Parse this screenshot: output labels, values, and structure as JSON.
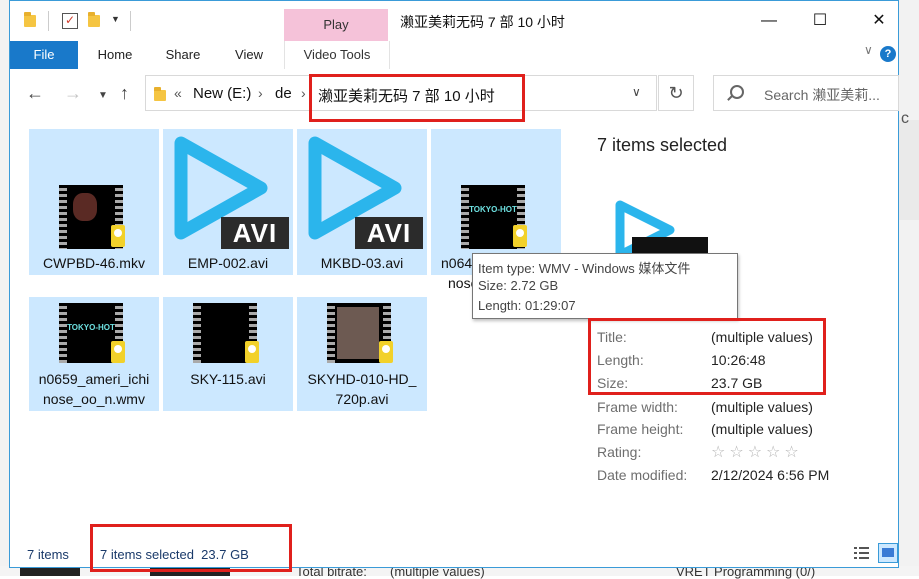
{
  "window": {
    "title": "濑亚美莉无码 7 部 10 小时",
    "context_tab": "Play"
  },
  "ribbon": {
    "tabs": [
      "File",
      "Home",
      "Share",
      "View",
      "Video Tools"
    ]
  },
  "nav": {
    "breadcrumb": [
      "New (E:)",
      "de",
      "濑亚美莉无码 7 部 10 小时"
    ],
    "crumb_overflow": "«",
    "search_placeholder": "Search 濑亚美莉..."
  },
  "files": [
    {
      "name": "CWPBD-46.mkv",
      "kind": "video-thumb"
    },
    {
      "name": "EMP-002.avi",
      "kind": "avi"
    },
    {
      "name": "MKBD-03.avi",
      "kind": "avi"
    },
    {
      "name": "n0648_ameri_ichinose",
      "caption_visible": [
        "n064",
        "nose"
      ],
      "kind": "tokyo-hot"
    },
    {
      "name": "n0659_ameri_ichinose_oo_n.wmv",
      "caption_lines": [
        "n0659_ameri_ichi",
        "nose_oo_n.wmv"
      ],
      "kind": "tokyo-hot"
    },
    {
      "name": "SKY-115.avi",
      "kind": "video-thumb"
    },
    {
      "name": "SKYHD-010-HD_720p.avi",
      "caption_lines": [
        "SKYHD-010-HD_",
        "720p.avi"
      ],
      "kind": "video-thumb"
    }
  ],
  "avi_badge": "AVI",
  "thumb_badge": "Player",
  "thumb_overlay": "TOKYO-HOT",
  "tooltip": {
    "item_type": "Item type: WMV - Windows 媒体文件",
    "size": "Size: 2.72 GB",
    "length": "Length: 01:29:07"
  },
  "details": {
    "heading": "7 items selected",
    "properties": [
      {
        "key": "Title:",
        "value": "(multiple values)"
      },
      {
        "key": "Length:",
        "value": "10:26:48"
      },
      {
        "key": "Size:",
        "value": "23.7 GB"
      },
      {
        "key": "Frame width:",
        "value": "(multiple values)"
      },
      {
        "key": "Frame height:",
        "value": "(multiple values)"
      },
      {
        "key": "Rating:",
        "value": "☆☆☆☆☆"
      },
      {
        "key": "Date modified:",
        "value": "2/12/2024 6:56 PM"
      }
    ]
  },
  "status": {
    "count": "7 items",
    "selection": "7 items selected  23.7 GB"
  },
  "background": {
    "right_glyph": "c",
    "bottom_texts": [
      "Total bitrate:",
      "(multiple values)",
      "VRET Programming (0/)"
    ]
  },
  "colors": {
    "accent": "#1979ca",
    "selection": "#cce8ff",
    "context_tab": "#f5c2d9",
    "highlight_box": "#e0201c",
    "avi_play": "#2bb5ec"
  }
}
